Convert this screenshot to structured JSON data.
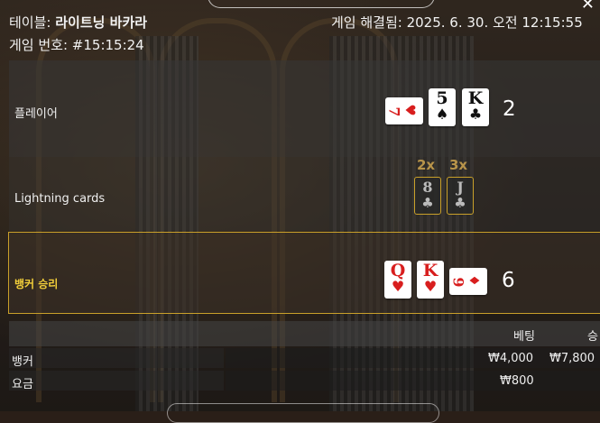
{
  "header": {
    "table_prefix": "테이블:",
    "table_name": "라이트닝 바카라",
    "game_number": "게임 번호: #15:15:24",
    "settled": "게임 해결됨: 2025. 6. 30. 오전 12:15:55"
  },
  "rows": {
    "player_label": "플레이어",
    "player_score": "2",
    "lightning_label": "Lightning cards",
    "banker_label": "뱅커 승리",
    "banker_score": "6"
  },
  "player_cards": [
    {
      "rank": "7",
      "suit": "♥",
      "color": "#d81e1e"
    },
    {
      "rank": "5",
      "suit": "♠",
      "color": "#111111"
    },
    {
      "rank": "K",
      "suit": "♣",
      "color": "#111111"
    }
  ],
  "lightning": [
    {
      "multiplier": "2x",
      "rank": "8",
      "suit": "♣"
    },
    {
      "multiplier": "3x",
      "rank": "J",
      "suit": "♣"
    }
  ],
  "banker_cards": [
    {
      "rank": "Q",
      "suit": "♥",
      "color": "#d81e1e"
    },
    {
      "rank": "K",
      "suit": "♥",
      "color": "#d81e1e"
    },
    {
      "rank": "9",
      "suit": "♦",
      "color": "#d81e1e"
    }
  ],
  "table": {
    "col_bet": "베팅",
    "col_win": "승",
    "rows": [
      {
        "label": "뱅커",
        "bet": "₩4,000",
        "win": "₩7,800"
      },
      {
        "label": "요금",
        "bet": "₩800",
        "win": ""
      }
    ]
  },
  "colors": {
    "accent": "#c9a02a",
    "winner_label": "#f3cf3a",
    "red_suit": "#d81e1e"
  },
  "icons": {
    "close": "close-icon"
  }
}
